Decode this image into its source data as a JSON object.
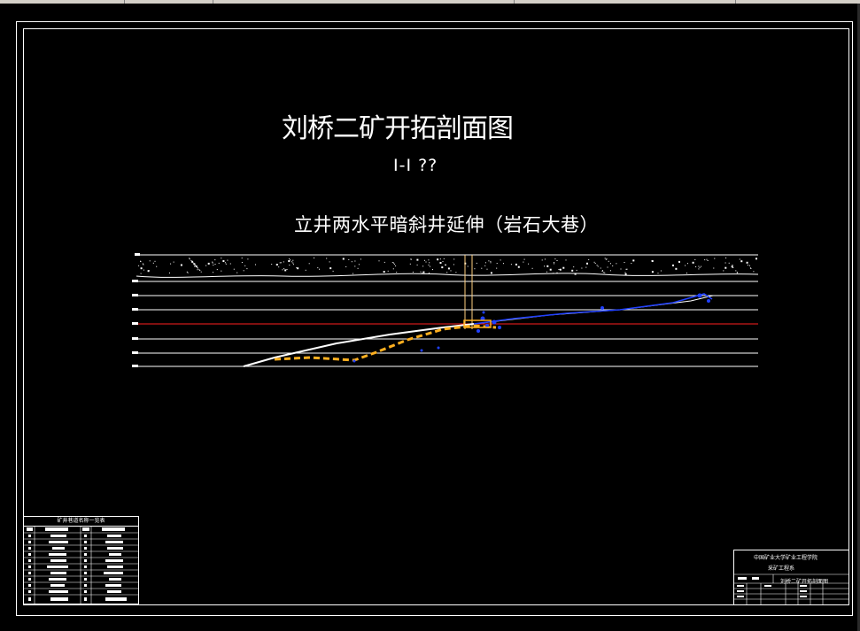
{
  "drawing": {
    "title": "刘桥二矿开拓剖面图",
    "subtitle": "Ⅰ-Ⅰ ??",
    "heading": "立井两水平暗斜井延伸（岩石大巷）"
  },
  "legend_table": {
    "title": "矿井巷道名称一览表"
  },
  "title_block": {
    "line1": "中国矿业大学矿业工程学院",
    "line2": "采矿工程系",
    "line3": "刘桥二矿开拓剖面图"
  },
  "colors": {
    "background": "#000000",
    "frame": "#ffffff",
    "level_line": "#ffffff",
    "red_level": "#ff2020",
    "roadway_orange": "#ffb020",
    "roadway_blue": "#2020ff",
    "shaft": "#ffd080"
  }
}
